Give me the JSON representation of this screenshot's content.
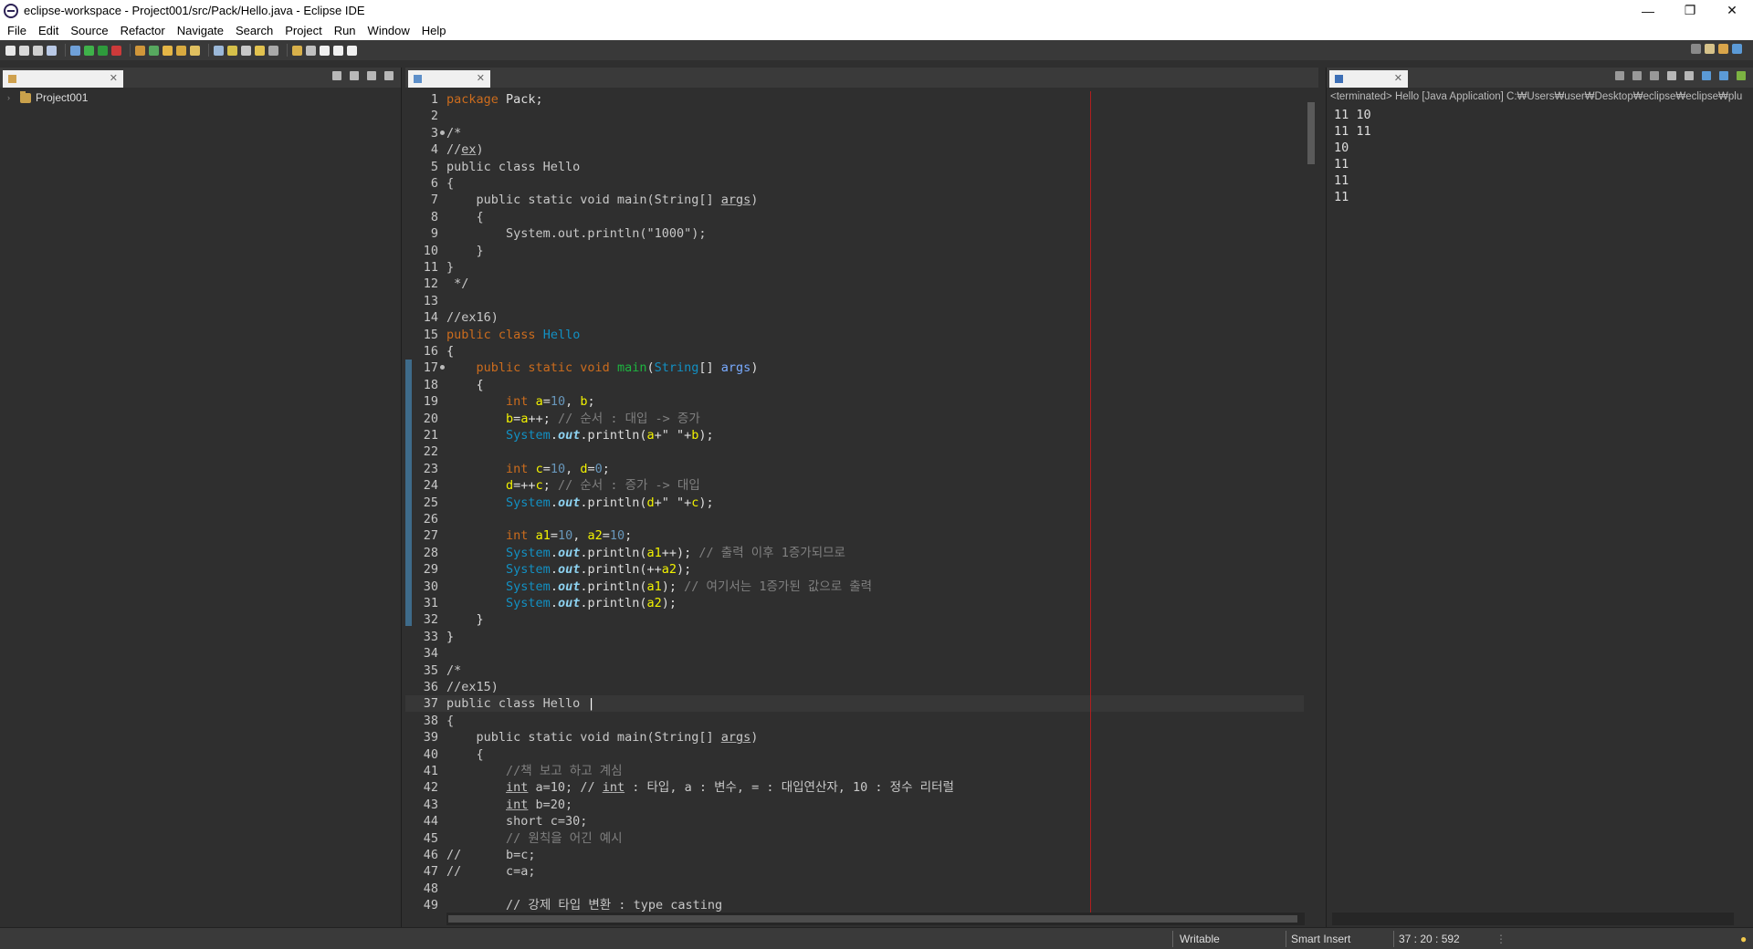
{
  "window": {
    "title": "eclipse-workspace - Project001/src/Pack/Hello.java - Eclipse IDE",
    "minimize": "—",
    "restore": "❐",
    "close": "✕"
  },
  "menu": [
    "File",
    "Edit",
    "Source",
    "Refactor",
    "Navigate",
    "Search",
    "Project",
    "Run",
    "Window",
    "Help"
  ],
  "package_explorer": {
    "tab_close": "✕",
    "project": "Project001"
  },
  "editor": {
    "tab_close": "✕",
    "cursor_line": 37
  },
  "code_lines": [
    {
      "n": "1",
      "html": "<span class=\"kw\">package</span> Pack;"
    },
    {
      "n": "2",
      "html": ""
    },
    {
      "n": "3",
      "fold": true,
      "html": "<span class=\"dim\">/*</span>"
    },
    {
      "n": "4",
      "html": "<span class=\"dim\">//<span class=\"warn\">ex</span>)</span>"
    },
    {
      "n": "5",
      "html": "<span class=\"dim\">public class Hello</span>"
    },
    {
      "n": "6",
      "html": "<span class=\"dim\">{</span>"
    },
    {
      "n": "7",
      "html": "<span class=\"dim\">    public static void main(String[] <span class=\"warn\">args</span>)</span>"
    },
    {
      "n": "8",
      "html": "<span class=\"dim\">    {</span>"
    },
    {
      "n": "9",
      "html": "<span class=\"dim\">        System.out.println(\"1000\");</span>"
    },
    {
      "n": "10",
      "html": "<span class=\"dim\">    }</span>"
    },
    {
      "n": "11",
      "html": "<span class=\"dim\">}</span>"
    },
    {
      "n": "12",
      "html": "<span class=\"dim\"> */</span>"
    },
    {
      "n": "13",
      "html": ""
    },
    {
      "n": "14",
      "html": "<span class=\"dim\">//ex16)</span>"
    },
    {
      "n": "15",
      "html": "<span class=\"kw\">public class</span> <span class=\"ty\">Hello</span>"
    },
    {
      "n": "16",
      "html": "{"
    },
    {
      "n": "17",
      "fold": true,
      "html": "    <span class=\"kw\">public static void</span> <span class=\"cls\">main</span>(<span class=\"ty\">String</span>[] <span class=\"prm\">args</span>)"
    },
    {
      "n": "18",
      "html": "    {"
    },
    {
      "n": "19",
      "html": "        <span class=\"kw\">int</span> <span class=\"var\">a</span>=<span class=\"num\">10</span>, <span class=\"var\">b</span>;"
    },
    {
      "n": "20",
      "html": "        <span class=\"var\">b</span>=<span class=\"var\">a</span>++; <span class=\"cm\">// 순서 : 대입 -> 증가</span>"
    },
    {
      "n": "21",
      "html": "        <span class=\"ty\">System</span>.<span class=\"field\">out</span>.println(<span class=\"var\">a</span>+\" \"+<span class=\"var\">b</span>);"
    },
    {
      "n": "22",
      "html": ""
    },
    {
      "n": "23",
      "html": "        <span class=\"kw\">int</span> <span class=\"var\">c</span>=<span class=\"num\">10</span>, <span class=\"var\">d</span>=<span class=\"num\">0</span>;"
    },
    {
      "n": "24",
      "html": "        <span class=\"var\">d</span>=++<span class=\"var\">c</span>; <span class=\"cm\">// 순서 : 증가 -> 대입</span>"
    },
    {
      "n": "25",
      "html": "        <span class=\"ty\">System</span>.<span class=\"field\">out</span>.println(<span class=\"var\">d</span>+\" \"+<span class=\"var\">c</span>);"
    },
    {
      "n": "26",
      "html": ""
    },
    {
      "n": "27",
      "html": "        <span class=\"kw\">int</span> <span class=\"var\">a1</span>=<span class=\"num\">10</span>, <span class=\"var\">a2</span>=<span class=\"num\">10</span>;"
    },
    {
      "n": "28",
      "html": "        <span class=\"ty\">System</span>.<span class=\"field\">out</span>.println(<span class=\"var\">a1</span>++); <span class=\"cm\">// 출력 이후 1증가되므로</span>"
    },
    {
      "n": "29",
      "html": "        <span class=\"ty\">System</span>.<span class=\"field\">out</span>.println(++<span class=\"var\">a2</span>);"
    },
    {
      "n": "30",
      "html": "        <span class=\"ty\">System</span>.<span class=\"field\">out</span>.println(<span class=\"var\">a1</span>); <span class=\"cm\">// 여기서는 1증가된 값으로 출력</span>"
    },
    {
      "n": "31",
      "html": "        <span class=\"ty\">System</span>.<span class=\"field\">out</span>.println(<span class=\"var\">a2</span>);"
    },
    {
      "n": "32",
      "html": "    }"
    },
    {
      "n": "33",
      "html": "}"
    },
    {
      "n": "34",
      "html": ""
    },
    {
      "n": "35",
      "html": "<span class=\"dim\">/*</span>"
    },
    {
      "n": "36",
      "html": "<span class=\"dim\">//ex15)</span>"
    },
    {
      "n": "37",
      "html": "<span class=\"dim\">public class Hello </span><span style=\"color:#fff\">|</span>"
    },
    {
      "n": "38",
      "html": "<span class=\"dim\">{</span>"
    },
    {
      "n": "39",
      "html": "<span class=\"dim\">    public static void main(String[] <span class=\"warn\">args</span>)</span>"
    },
    {
      "n": "40",
      "html": "<span class=\"dim\">    {</span>"
    },
    {
      "n": "41",
      "html": "<span class=\"cm\">        //책 보고 하고 계심</span>"
    },
    {
      "n": "42",
      "html": "<span class=\"dim\">        <span class=\"warn\">int</span> a=10; // <span class=\"warn\">int</span> : 타입, a : 변수, = : 대입연산자, 10 : 정수 리터럴</span>"
    },
    {
      "n": "43",
      "html": "<span class=\"dim\">        <span class=\"warn\">int</span> b=20;</span>"
    },
    {
      "n": "44",
      "html": "<span class=\"dim\">        short c=30;</span>"
    },
    {
      "n": "45",
      "html": "<span class=\"cm\">        // 원칙을 어긴 예시</span>"
    },
    {
      "n": "46",
      "html": "<span class=\"dim\">//      b=c;</span>"
    },
    {
      "n": "47",
      "html": "<span class=\"dim\">//      c=a;</span>"
    },
    {
      "n": "48",
      "html": ""
    },
    {
      "n": "49",
      "html": "<span class=\"dim\">        // 강제 타입 변환 : type casting</span>"
    }
  ],
  "console": {
    "tab_close": "✕",
    "header": "<terminated> Hello [Java Application] C:₩Users₩user₩Desktop₩eclipse₩eclipse₩plu",
    "lines": [
      "11 10",
      "11 11",
      "10",
      "11",
      "11",
      "11"
    ]
  },
  "status": {
    "writable": "Writable",
    "insert_mode": "Smart Insert",
    "position": "37 : 20 : 592"
  },
  "toolbar_icons": [
    "new",
    "save",
    "save-all",
    "print",
    "debug",
    "run",
    "coverage",
    "external-tools",
    "new-java-project",
    "new-package",
    "new-class",
    "open-type",
    "search",
    "next-annotation",
    "prev-annotation",
    "back",
    "forward",
    "pin-editor"
  ]
}
